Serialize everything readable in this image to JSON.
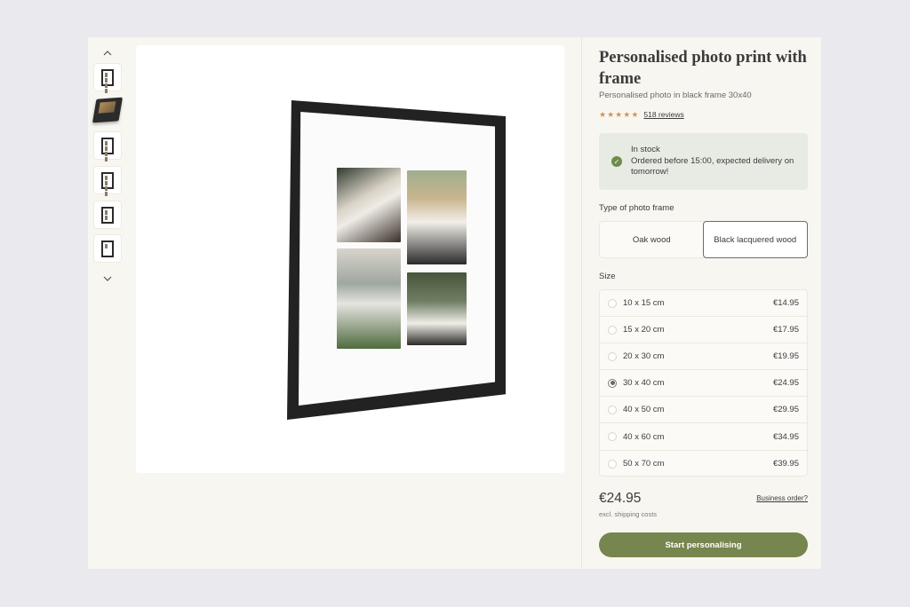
{
  "product": {
    "title": "Personalised photo print with frame",
    "subtitle": "Personalised photo in black frame 30x40",
    "rating_stars": 5,
    "reviews_label": "518 reviews"
  },
  "stock": {
    "status": "In stock",
    "delivery": "Ordered before 15:00, expected delivery on tomorrow!"
  },
  "frame_type": {
    "label": "Type of photo frame",
    "options": [
      "Oak wood",
      "Black lacquered wood"
    ],
    "selected": "Black lacquered wood"
  },
  "size": {
    "label": "Size",
    "options": [
      {
        "name": "10 x 15 cm",
        "price": "€14.95"
      },
      {
        "name": "15 x 20 cm",
        "price": "€17.95"
      },
      {
        "name": "20 x 30 cm",
        "price": "€19.95"
      },
      {
        "name": "30 x 40 cm",
        "price": "€24.95"
      },
      {
        "name": "40 x 50 cm",
        "price": "€29.95"
      },
      {
        "name": "40 x 60 cm",
        "price": "€34.95"
      },
      {
        "name": "50 x 70 cm",
        "price": "€39.95"
      }
    ],
    "selected": "30 x 40 cm"
  },
  "pricing": {
    "price": "€24.95",
    "shipping_note": "excl. shipping costs",
    "business_link": "Business order?"
  },
  "cta": {
    "label": "Start personalising"
  },
  "colors": {
    "accent": "#76864e",
    "star": "#d2955a",
    "stock_bg": "#e8ebe3",
    "panel_bg": "#f8f6f1"
  },
  "icons": {
    "thumbs_up": "chevron-up-icon",
    "thumbs_down": "chevron-down-icon",
    "stock": "check-circle-icon",
    "star": "star-icon"
  }
}
